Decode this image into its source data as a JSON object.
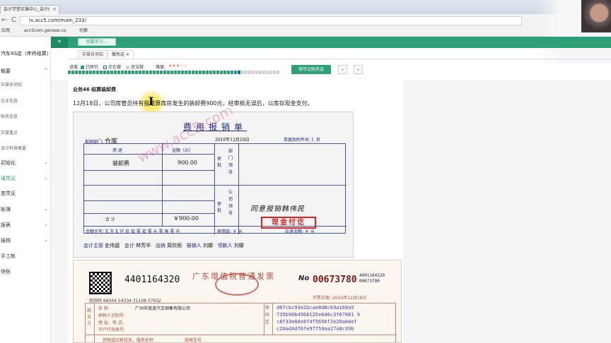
{
  "browser": {
    "tab_title": "会计学堂实操中心_会计t",
    "tab_close": "×",
    "nav_back": "←",
    "nav_forward": "→",
    "nav_reload": "C",
    "url": "lx.acc5.com/main_233/",
    "bookmarks": [
      "应用",
      "acc5com.gensee.co",
      "切换"
    ]
  },
  "header": {
    "collapse_glyph": "«",
    "module_select": "我要学习",
    "module_arrow": "⌵"
  },
  "sidebar": {
    "title": "汽车4S店（年终结算）",
    "items": [
      {
        "label": "概要",
        "chevron": "^",
        "sub": false
      },
      {
        "label": "实操员须知",
        "sub": true
      },
      {
        "label": "企业信息",
        "sub": true
      },
      {
        "label": "账务信息",
        "sub": true
      },
      {
        "label": "实操重点",
        "sub": true
      },
      {
        "label": "会计科目概要",
        "sub": true
      },
      {
        "label": "初始化",
        "chevron": "⌄",
        "sub": false
      },
      {
        "label": "填凭证",
        "chevron": "⌄",
        "sub": false
      },
      {
        "label": "查凭证",
        "sub": false
      },
      {
        "label": "账簿",
        "chevron": "⌄",
        "sub": false
      },
      {
        "label": "报表",
        "chevron": "⌄",
        "sub": false
      },
      {
        "label": "报税",
        "chevron": "⌄",
        "sub": false
      },
      {
        "label": "手工帐",
        "sub": false
      },
      {
        "label": "快账",
        "sub": false
      }
    ]
  },
  "content_tabs": [
    {
      "label": "实操员须知"
    },
    {
      "label": "做凭证",
      "close": "×"
    }
  ],
  "progress": {
    "label": "进度:",
    "legend": [
      "已研究",
      "正在做",
      "还没做"
    ],
    "difficulty_label": "难度:",
    "difficulty_stars": "★★★☆☆",
    "colors": {
      "done": "#2f9f77",
      "current": "#1565c0",
      "todo": "#d0d0d0"
    },
    "done_count": 48,
    "current_index": 48,
    "total": 60,
    "write_button": "填写记账凭证",
    "prev": "‹",
    "next": "›"
  },
  "task": {
    "title": "业务46 结算装卸费",
    "description": "12月18日，公司库管员持有报结算库房发生的装卸费900元，经审核无误后，以库存现金支付。",
    "cursor_glyph": "I"
  },
  "voucher": {
    "title": "费用报销单",
    "dept_label": "报销部门:",
    "dept_value": "仓库",
    "date": "2016年12月18日",
    "attach": "单据及附件共_1_页",
    "col_use": "用    途",
    "col_amount": "金额（元）",
    "approve1_label": "审批",
    "approve1_value": "部门领导",
    "approve2_label": "审批",
    "approve2_value": "公司领导",
    "row1_use": "装卸费",
    "row1_amount": "900.00",
    "total_label": "合            计",
    "total_amount": "￥900.00",
    "capital_label": "金额大写: X 万 X 仟 玖 佰 零 拾 零 元 零 角 零 分",
    "original": "原借款:   ￥      元",
    "refund": "应退余额:   ￥      元",
    "handwritten": "同意报销韩伟民",
    "stamp": "现金付讫",
    "footer": [
      {
        "role": "会计主管",
        "name": "史伟庭"
      },
      {
        "role": "会计",
        "name": "林芳华"
      },
      {
        "role": "出纳",
        "name": "周欣雨"
      },
      {
        "role": "报销人",
        "name": "刘娜"
      },
      {
        "role": "领款人",
        "name": "刘娜"
      }
    ],
    "watermark": "www.acc5.com"
  },
  "invoice": {
    "code": "4401164320",
    "title": "广东增值税普通发票",
    "no_label": "No",
    "number": "00673780",
    "small_code": "4401164320",
    "small_number": "00673780",
    "date": "开票日期: 2016年12月18日",
    "check_code": "校验码 68564 54334 31108 07932",
    "buyer_label": "购买方",
    "name_label": "名        称:",
    "name_value": "广州市南凌汽车销售有限公司",
    "taxid_label": "纳税人识别号:",
    "address_label": "地 址、电 话:",
    "bank_label": "开户行及账号:",
    "password_label": "密码区",
    "codes": [
      "d07cbc93e2bcae8d8c69a169a5",
      "735b90b4568125e6d6c3f67881 9",
      "c8f33e8de874f5656f2e20a04ef",
      "c20ad4d76fe97759aa27a0c99b"
    ],
    "goods_header": "货物或应税劳务、服务名称",
    "spec_header": "规格型号"
  }
}
